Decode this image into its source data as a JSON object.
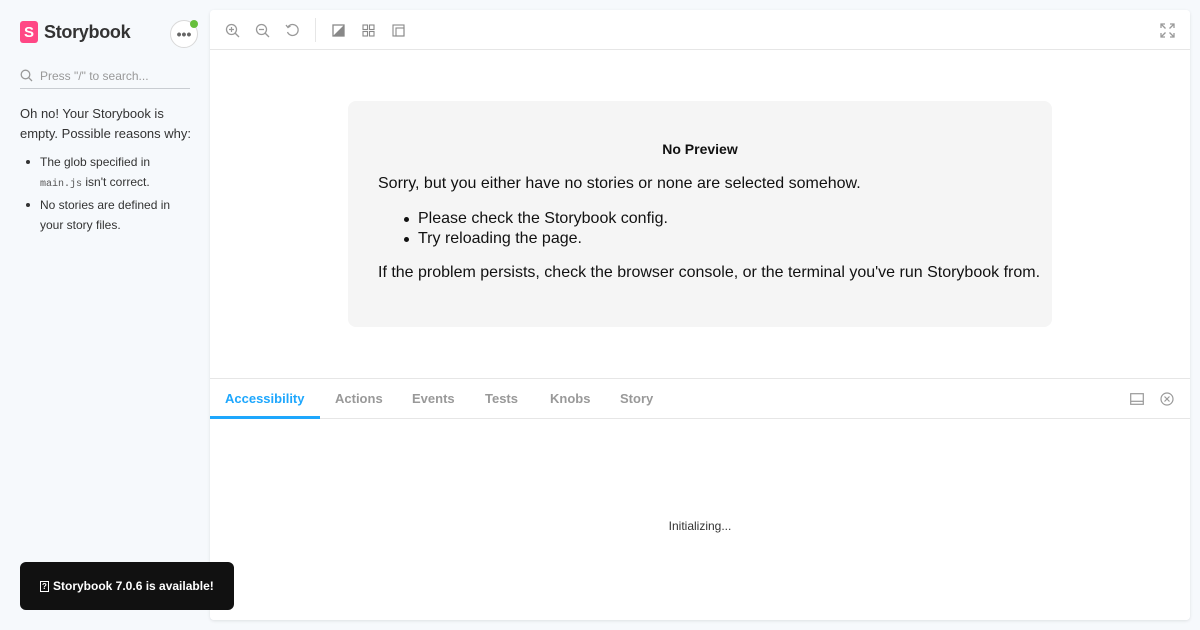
{
  "sidebar": {
    "brand": {
      "logo_letter": "S",
      "name": "Storybook",
      "logo_color": "#ff4785"
    },
    "menu_button": {
      "icon": "ellipsis-icon",
      "status_color": "#66bf3c"
    },
    "search": {
      "placeholder": "Press \"/\" to search...",
      "value": ""
    },
    "empty": {
      "message": "Oh no! Your Storybook is empty. Possible reasons why:",
      "reasons": [
        {
          "pre": "The glob specified in ",
          "code": "main.js",
          "post": " isn't correct."
        },
        {
          "text": "No stories are defined in your story files."
        }
      ]
    }
  },
  "toolbar": {
    "left_tools": [
      "zoom-in-icon",
      "zoom-out-icon",
      "zoom-reset-icon",
      "background-icon",
      "grid-icon",
      "outline-icon"
    ],
    "right_tools": [
      "fullscreen-icon"
    ]
  },
  "preview": {
    "title": "No Preview",
    "body": "Sorry, but you either have no stories or none are selected somehow.",
    "items": [
      "Please check the Storybook config.",
      "Try reloading the page."
    ],
    "footer": "If the problem persists, check the browser console, or the terminal you've run Storybook from."
  },
  "addons": {
    "tabs": [
      {
        "label": "Accessibility",
        "active": true
      },
      {
        "label": "Actions",
        "active": false
      },
      {
        "label": "Events",
        "active": false
      },
      {
        "label": "Tests",
        "active": false
      },
      {
        "label": "Knobs",
        "active": false
      },
      {
        "label": "Story",
        "active": false
      }
    ],
    "status": "Initializing...",
    "accent_color": "#1ea7fd",
    "right_icons": [
      "panel-position-icon",
      "close-panel-icon"
    ]
  },
  "notification": {
    "icon": "?",
    "text": "Storybook 7.0.6 is available!"
  }
}
